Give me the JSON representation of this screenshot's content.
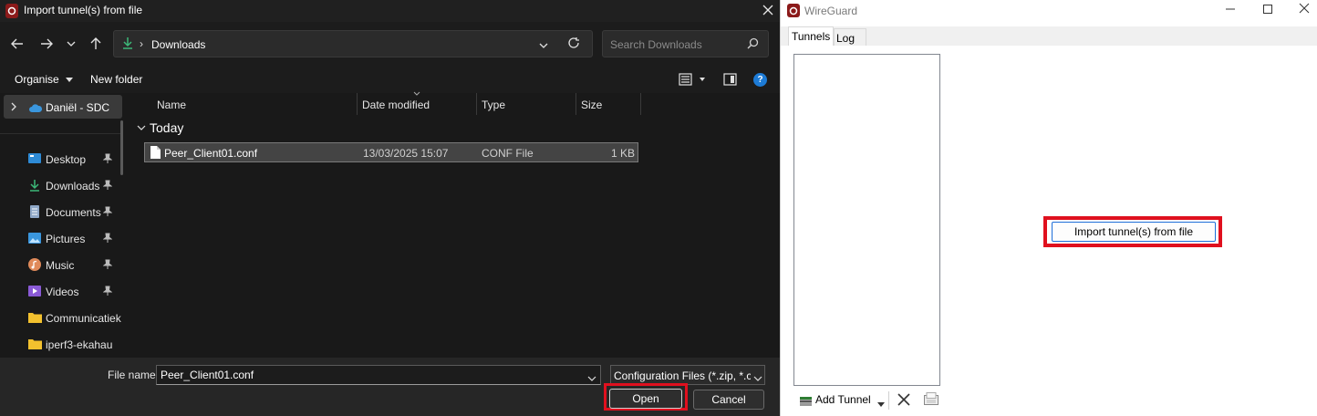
{
  "dialog": {
    "title": "Import tunnel(s) from file",
    "address": {
      "current_folder": "Downloads"
    },
    "search": {
      "placeholder": "Search Downloads"
    },
    "commands": {
      "organise": "Organise",
      "new_folder": "New folder",
      "help": "?"
    },
    "sidebar": {
      "account": "Daniël - SDC",
      "items": [
        {
          "label": "Desktop",
          "icon": "desktop-icon",
          "pinned": true
        },
        {
          "label": "Downloads",
          "icon": "downloads-icon",
          "pinned": true
        },
        {
          "label": "Documents",
          "icon": "documents-icon",
          "pinned": true
        },
        {
          "label": "Pictures",
          "icon": "pictures-icon",
          "pinned": true
        },
        {
          "label": "Music",
          "icon": "music-icon",
          "pinned": true
        },
        {
          "label": "Videos",
          "icon": "videos-icon",
          "pinned": true
        },
        {
          "label": "Communicatiek",
          "icon": "folder-icon",
          "pinned": false
        },
        {
          "label": "iperf3-ekahau",
          "icon": "folder-icon",
          "pinned": false
        }
      ]
    },
    "columns": [
      "Name",
      "Date modified",
      "Type",
      "Size"
    ],
    "group": "Today",
    "files": [
      {
        "name": "Peer_Client01.conf",
        "date_modified": "13/03/2025 15:07",
        "type": "CONF File",
        "size": "1 KB"
      }
    ],
    "footer": {
      "file_name_label": "File name:",
      "file_name_value": "Peer_Client01.conf",
      "file_type": "Configuration Files (*.zip, *.con",
      "open_label": "Open",
      "cancel_label": "Cancel"
    }
  },
  "wireguard": {
    "title": "WireGuard",
    "tabs": [
      "Tunnels",
      "Log"
    ],
    "add_tunnel_label": "Add Tunnel",
    "import_button_label": "Import tunnel(s) from file"
  },
  "colors": {
    "highlight": "#e0101e",
    "dialog_bg": "#191919",
    "accent_blue": "#1d7bd6",
    "wireguard_red": "#8b1a1a"
  }
}
